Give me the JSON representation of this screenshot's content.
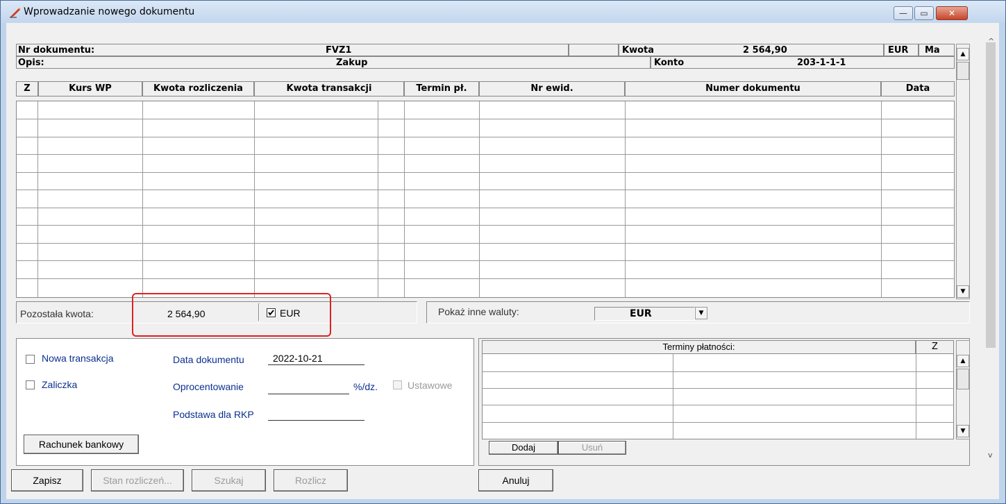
{
  "window": {
    "title": "Wprowadzanie nowego dokumentu",
    "buttons": {
      "minimize": "—",
      "maximize": "▭",
      "close": "✕"
    }
  },
  "header": {
    "doc_number_label": "Nr dokumentu:",
    "doc_number_value": "FVZ1",
    "amount_label": "Kwota",
    "amount_value": "2 564,90",
    "currency": "EUR",
    "side": "Ma",
    "desc_label": "Opis:",
    "desc_value": "Zakup",
    "account_label": "Konto",
    "account_value": "203-1-1-1"
  },
  "grid": {
    "columns": [
      "Z",
      "Kurs WP",
      "Kwota rozliczenia",
      "Kwota transakcji",
      "Termin pł.",
      "Nr ewid.",
      "Numer dokumentu",
      "Data"
    ]
  },
  "info": {
    "remaining_label": "Pozostała kwota:",
    "remaining_value": "2 564,90",
    "currency_checkbox_label": "EUR",
    "show_other_label": "Pokaż inne waluty:",
    "currency_select_value": "EUR"
  },
  "left_panel": {
    "new_transaction": "Nowa transakcja",
    "advance": "Zaliczka",
    "doc_date_label": "Data dokumentu",
    "doc_date_value": "2022-10-21",
    "interest_label": "Oprocentowanie",
    "interest_unit": "%/dz.",
    "statutory": "Ustawowe",
    "rkp_label": "Podstawa dla RKP",
    "bank_account_button": "Rachunek bankowy"
  },
  "right_panel": {
    "terms_header": "Terminy płatności:",
    "z_header": "Z",
    "add_button": "Dodaj",
    "remove_button": "Usuń"
  },
  "footer": {
    "save": "Zapisz",
    "settlement_state": "Stan rozliczeń...",
    "search": "Szukaj",
    "settle": "Rozlicz",
    "cancel": "Anuluj"
  },
  "colors": {
    "highlight_border": "#e02020",
    "label_blue": "#0b2f8f",
    "title_bg": "#c8daef"
  },
  "icons": [
    "pen-icon",
    "scroll-up-icon",
    "scroll-down-icon",
    "dropdown-arrow-icon",
    "checkbox-checked-icon"
  ]
}
